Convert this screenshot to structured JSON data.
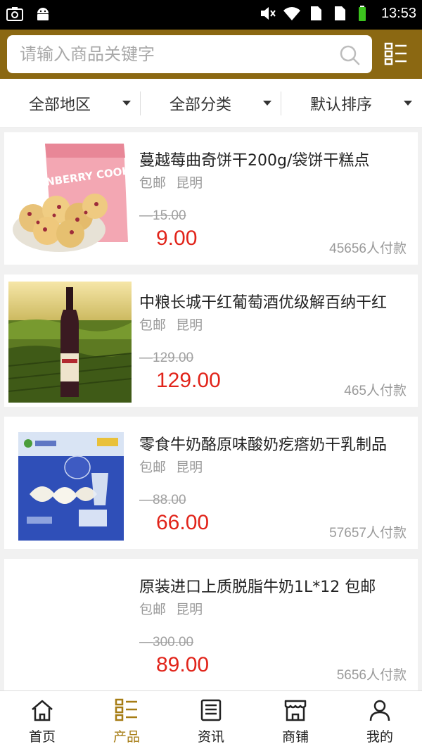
{
  "status_bar": {
    "time": "13:53"
  },
  "search": {
    "placeholder": "请输入商品关键字"
  },
  "filters": [
    {
      "label": "全部地区"
    },
    {
      "label": "全部分类"
    },
    {
      "label": "默认排序"
    }
  ],
  "products": [
    {
      "title": "蔓越莓曲奇饼干200g/袋饼干糕点",
      "shipping": "包邮",
      "city": "昆明",
      "old_price": "15.00",
      "price": "9.00",
      "sold": "45656人付款",
      "thumb_text": "CRANBERRY COOKIES"
    },
    {
      "title": "中粮长城干红葡萄酒优级解百纳干红",
      "shipping": "包邮",
      "city": "昆明",
      "old_price": "129.00",
      "price": "129.00",
      "sold": "465人付款"
    },
    {
      "title": "零食牛奶酪原味酸奶疙瘩奶干乳制品",
      "shipping": "包邮",
      "city": "昆明",
      "old_price": "88.00",
      "price": "66.00",
      "sold": "57657人付款"
    },
    {
      "title": "原装进口上质脱脂牛奶1L*12 包邮",
      "shipping": "包邮",
      "city": "昆明",
      "old_price": "300.00",
      "price": "89.00",
      "sold": "5656人付款"
    }
  ],
  "bottom_nav": [
    {
      "label": "首页",
      "icon": "home-icon"
    },
    {
      "label": "产品",
      "icon": "product-list-icon",
      "active": true
    },
    {
      "label": "资讯",
      "icon": "news-icon"
    },
    {
      "label": "商铺",
      "icon": "shop-icon"
    },
    {
      "label": "我的",
      "icon": "user-icon"
    }
  ],
  "colors": {
    "header": "#8b6812",
    "price": "#e1241a",
    "active_tab": "#a67c14"
  }
}
